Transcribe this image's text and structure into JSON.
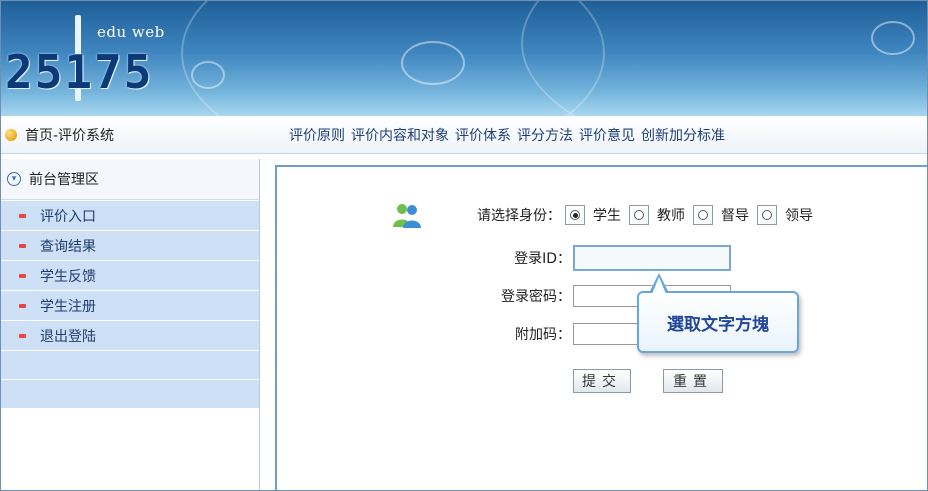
{
  "banner": {
    "logo_text": "25175",
    "logo_sub": "edu web"
  },
  "menubar": {
    "home_label": "首页-评价系统",
    "links": [
      "评价原则",
      "评价内容和对象",
      "评价体系",
      "评分方法",
      "评价意见",
      "创新加分标准"
    ]
  },
  "sidebar": {
    "title": "前台管理区",
    "items": [
      {
        "label": "评价入口"
      },
      {
        "label": "查询结果"
      },
      {
        "label": "学生反馈"
      },
      {
        "label": "学生注册"
      },
      {
        "label": "退出登陆"
      }
    ]
  },
  "form": {
    "role_label": "请选择身份：",
    "roles": [
      "学生",
      "教师",
      "督导",
      "领导"
    ],
    "selected_role": "学生",
    "login_id_label": "登录ID：",
    "password_label": "登录密码：",
    "extra_code_label": "附加码：",
    "submit_label": "提交",
    "reset_label": "重置"
  },
  "tooltip": {
    "text": "選取文字方塊"
  },
  "colors": {
    "banner_top": "#1f5f98",
    "sidebar_item_bg": "#cde0f6",
    "link": "#1d3f78"
  }
}
